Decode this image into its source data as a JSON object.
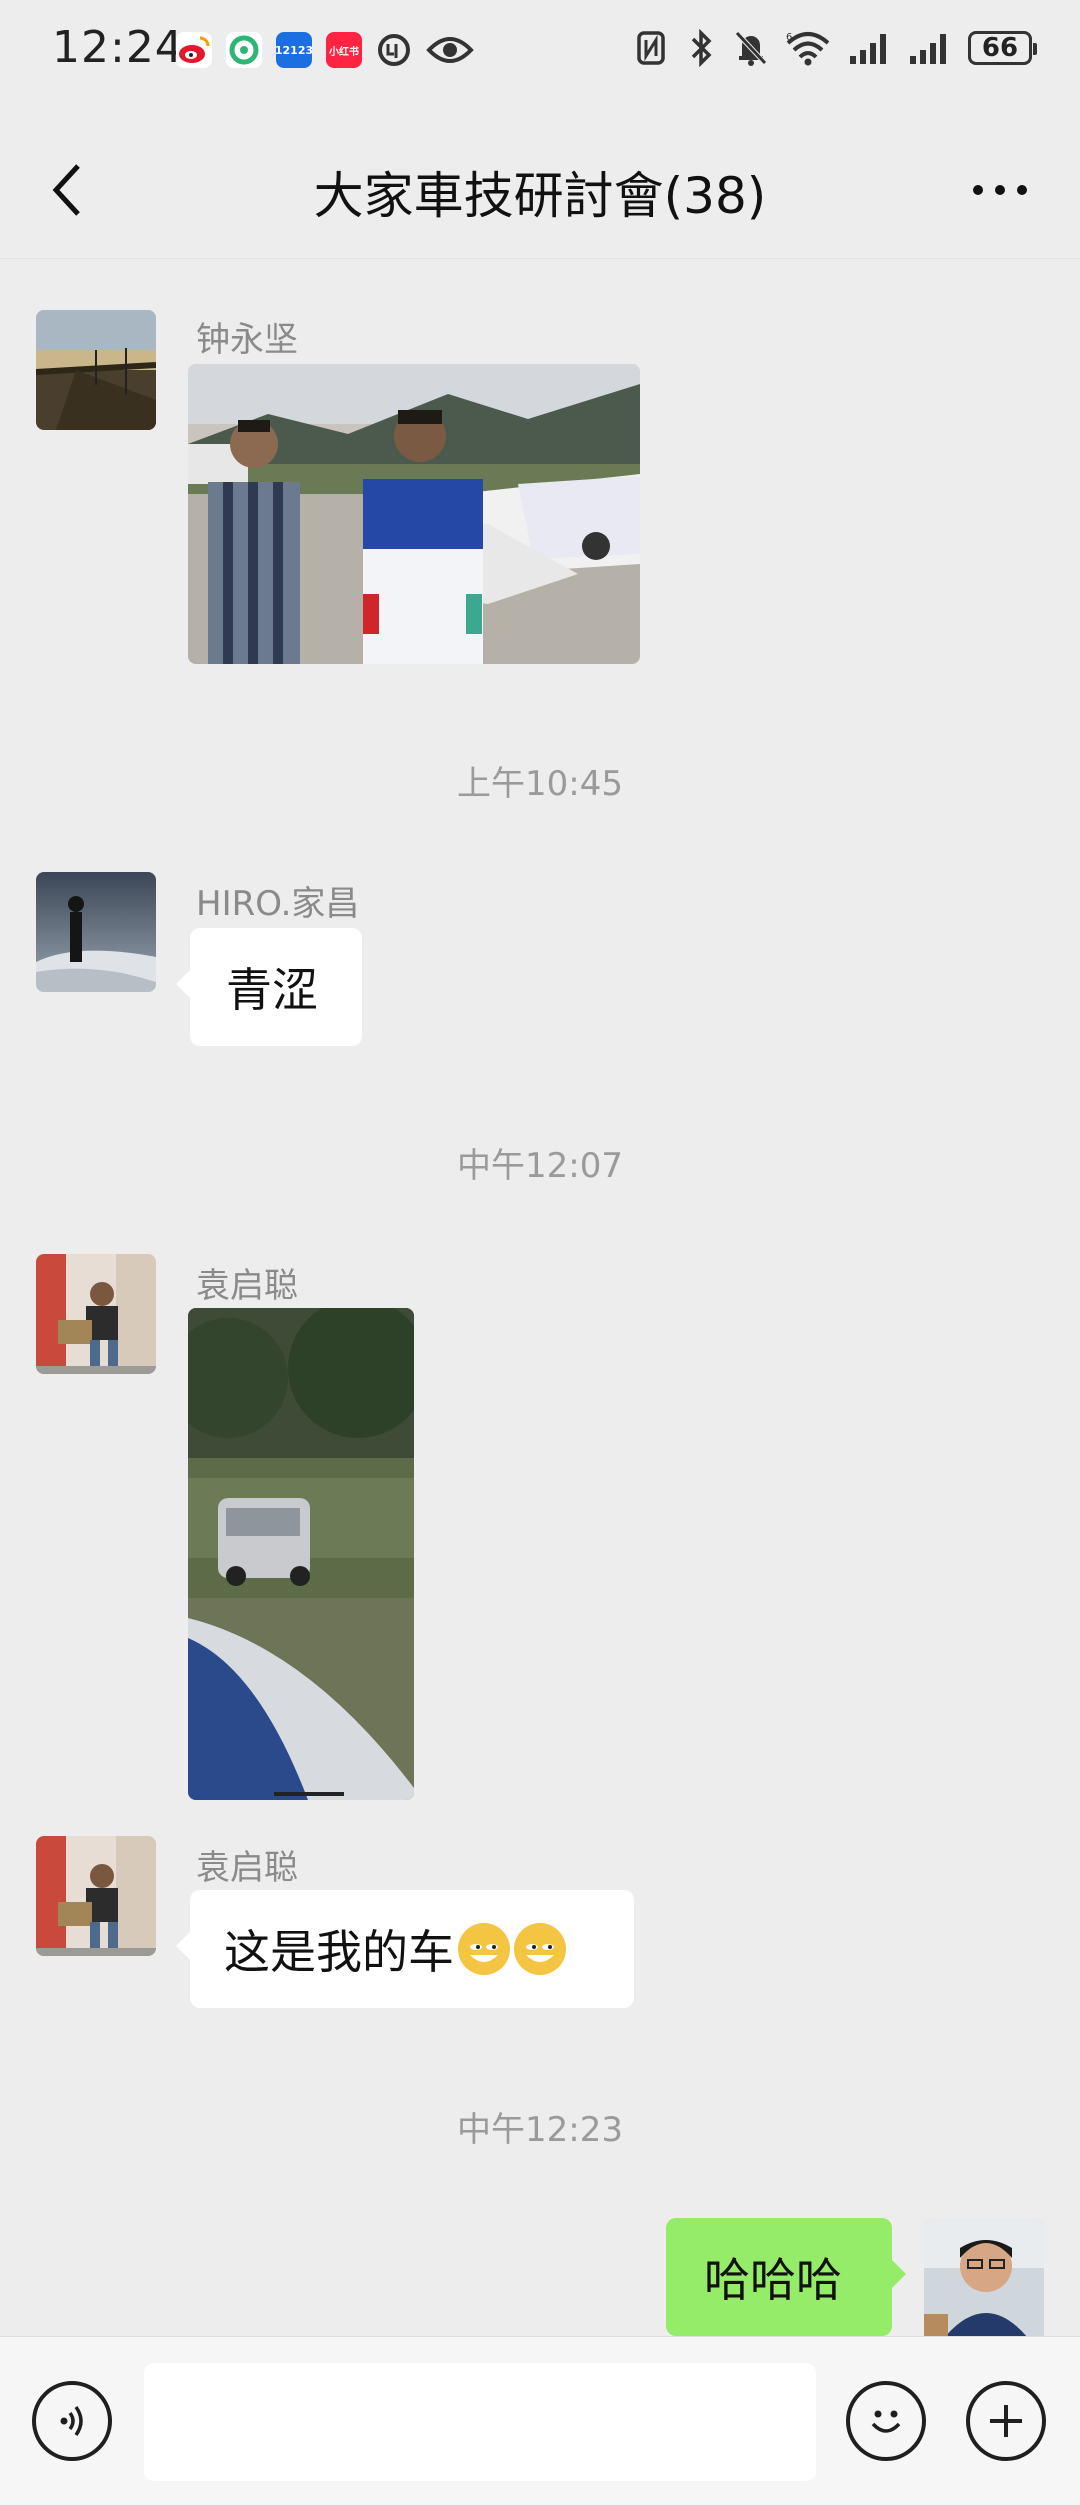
{
  "status_bar": {
    "time": "12:24",
    "app_icons": [
      "weibo-icon",
      "app-green-icon",
      "12123-icon",
      "xiaohongshu-icon",
      "circle-app-icon",
      "eye-icon"
    ],
    "icon_12123": "12123",
    "icon_xhs": "小红书",
    "battery": "66"
  },
  "header": {
    "title": "大家車技研討會(38)"
  },
  "messages": [
    {
      "type": "image",
      "sender": "钟永坚"
    },
    {
      "type": "time",
      "text": "上午10:45"
    },
    {
      "type": "text",
      "sender": "HIRO.家昌",
      "text": "青涩"
    },
    {
      "type": "time",
      "text": "中午12:07"
    },
    {
      "type": "image",
      "sender": "袁启聪"
    },
    {
      "type": "text",
      "sender": "袁启聪",
      "text": "这是我的车"
    },
    {
      "type": "time",
      "text": "中午12:23"
    },
    {
      "type": "text",
      "sender": "me",
      "text": "哈哈哈"
    }
  ],
  "input": {
    "placeholder": ""
  },
  "colors": {
    "background": "#ededed",
    "my_bubble": "#95ec69",
    "other_bubble": "#ffffff",
    "input_bar": "#f6f6f6"
  }
}
